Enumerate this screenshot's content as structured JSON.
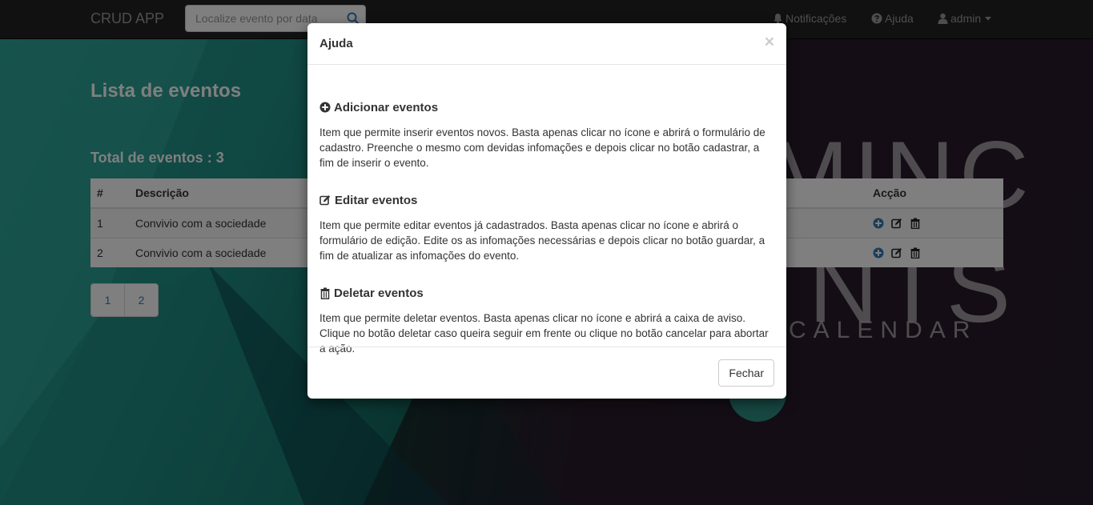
{
  "navbar": {
    "brand": "CRUD APP",
    "search_placeholder": "Localize evento por data",
    "notifications": "Notificações",
    "help": "Ajuda",
    "user": "admin"
  },
  "background": {
    "word_top": "MINC",
    "word_bottom": "NTS",
    "tagline": "CALENDAR"
  },
  "page": {
    "title": "Lista de eventos",
    "total": "Total de eventos : 3",
    "table": {
      "headers": [
        "#",
        "Descrição",
        "Acção"
      ],
      "rows": [
        {
          "num": "1",
          "desc": "Convivio com a sociedade"
        },
        {
          "num": "2",
          "desc": "Convivio com a sociedade"
        }
      ]
    },
    "pagination": [
      "1",
      "2"
    ]
  },
  "modal": {
    "title": "Ajuda",
    "close_glyph": "×",
    "sections": [
      {
        "icon": "plus-circle-icon",
        "title": "Adicionar eventos",
        "text": "Item que permite inserir eventos novos. Basta apenas clicar no ícone e abrirá o formulário de cadastro. Preenche o mesmo com devidas infomações e depois clicar no botão cadastrar, a fim de inserir o evento."
      },
      {
        "icon": "edit-icon",
        "title": "Editar eventos",
        "text": "Item que permite editar eventos já cadastrados. Basta apenas clicar no ícone e abrirá o formulário de edição. Edite os as infomações necessárias e depois clicar no botão guardar, a fim de atualizar as infomações do evento."
      },
      {
        "icon": "trash-icon",
        "title": "Deletar eventos",
        "text": "Item que permite deletar eventos. Basta apenas clicar no ícone e abrirá a caixa de aviso. Clique no botão deletar caso queira seguir em frente ou clique no botão cancelar para abortar a ação."
      }
    ],
    "footer_button": "Fechar"
  },
  "colors": {
    "navbar": "#222222",
    "accent_teal": "#208f86",
    "link_blue": "#337ab7"
  }
}
